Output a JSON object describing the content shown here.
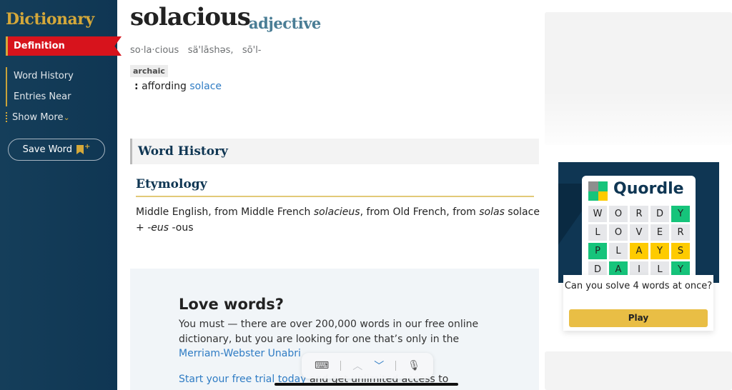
{
  "sidebar": {
    "title": "Dictionary",
    "active_item": "Definition",
    "items": [
      {
        "label": "Word History"
      },
      {
        "label": "Entries Near"
      }
    ],
    "show_more": "Show More",
    "save_word": "Save Word"
  },
  "entry": {
    "headword": "solacious",
    "part_of_speech": "adjective",
    "pronunciation": "so·la·cious   sä'lāshəs,   sō'l-",
    "label": "archaic",
    "definition_prefix": ":",
    "definition_text": "affording",
    "definition_link": "solace"
  },
  "word_history": {
    "section_title": "Word History",
    "etymology_title": "Etymology",
    "etymology": {
      "p1": "Middle English, from Middle French ",
      "i1": "solacieus",
      "p2": ", from Old French, from ",
      "i2": "solas",
      "p3": " solace + ",
      "i3": "-eus",
      "p4": " -ous"
    }
  },
  "promo": {
    "title": "Love words?",
    "body": "You must — there are over 200,000 words in our free online dictionary, but you are looking for one that’s only in the",
    "link": "Merriam-Webster Unabri",
    "trial_link": "Start your free trial today",
    "trial_rest": " and get unlimited access to"
  },
  "keyboard_toolbar": {
    "icons": [
      "keyboard-icon",
      "chevron-up-icon",
      "chevron-down-icon",
      "microphone-icon"
    ]
  },
  "quordle_ad": {
    "brand": "Quordle",
    "grid": [
      [
        {
          "l": "W",
          "s": ""
        },
        {
          "l": "O",
          "s": ""
        },
        {
          "l": "R",
          "s": ""
        },
        {
          "l": "D",
          "s": ""
        },
        {
          "l": "Y",
          "s": "g"
        }
      ],
      [
        {
          "l": "L",
          "s": ""
        },
        {
          "l": "O",
          "s": ""
        },
        {
          "l": "V",
          "s": ""
        },
        {
          "l": "E",
          "s": ""
        },
        {
          "l": "R",
          "s": ""
        }
      ],
      [
        {
          "l": "P",
          "s": "g"
        },
        {
          "l": "L",
          "s": ""
        },
        {
          "l": "A",
          "s": "y"
        },
        {
          "l": "Y",
          "s": "y"
        },
        {
          "l": "S",
          "s": "y"
        }
      ],
      [
        {
          "l": "D",
          "s": ""
        },
        {
          "l": "A",
          "s": "g"
        },
        {
          "l": "I",
          "s": ""
        },
        {
          "l": "L",
          "s": ""
        },
        {
          "l": "Y",
          "s": "g"
        }
      ]
    ],
    "logo_colors": [
      "#8e8e8e",
      "#16c47b",
      "#16c47b",
      "#fecb00"
    ],
    "question": "Can you solve 4 words at once?",
    "play_label": "Play"
  },
  "colors": {
    "sidebar_bg": "#0f3653",
    "accent_red": "#d7131c",
    "accent_gold": "#d4a83a",
    "link_blue": "#2f7cc4"
  }
}
